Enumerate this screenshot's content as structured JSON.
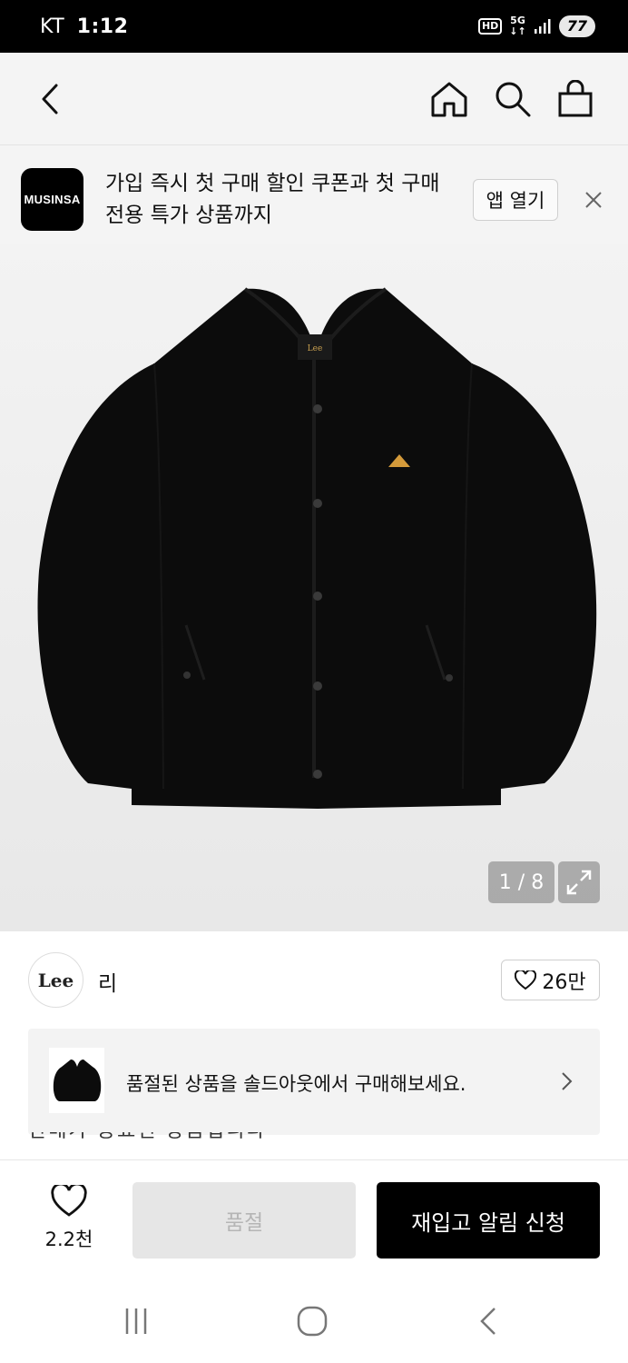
{
  "status_bar": {
    "carrier": "KT",
    "time": "1:12",
    "hd_label": "HD",
    "network_label": "5G",
    "battery": "77"
  },
  "icons": {
    "back": "chevron-left-icon",
    "home": "home-icon",
    "search": "search-icon",
    "bag": "shopping-bag-icon",
    "close": "close-icon",
    "expand": "expand-icon",
    "heart": "heart-icon",
    "chevron": "chevron-right-icon"
  },
  "app_banner": {
    "logo_text": "MUSINSA",
    "message": "가입 즉시 첫 구매 할인 쿠폰과 첫 구매 전용 특가 상품까지",
    "open_app_label": "앱 열기"
  },
  "product": {
    "image_counter": "1 / 8",
    "brand_logo_text": "Lee",
    "brand_name": "리",
    "brand_like_count": "26만"
  },
  "soldout_card": {
    "text": "품절된 상품을 솔드아웃에서 구매해보세요."
  },
  "peek_text": "판매가 종료된 상품입니다",
  "action_bar": {
    "wish_count": "2.2천",
    "soldout_label": "품절",
    "restock_label": "재입고 알림 신청"
  },
  "colors": {
    "primary_button": "#000000",
    "disabled_button": "#e6e6e6",
    "disabled_text": "#b5b5b5",
    "header_bg": "#f4f4f4"
  }
}
